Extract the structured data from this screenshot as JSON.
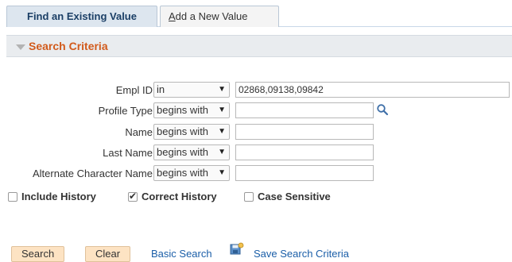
{
  "tabs": {
    "active": "Find an Existing Value",
    "inactive_accel": "A",
    "inactive_rest": "dd a New Value"
  },
  "section": {
    "title": "Search Criteria"
  },
  "fields": [
    {
      "label": "Empl ID",
      "operator": "in",
      "value": "02868,09138,09842"
    },
    {
      "label": "Profile Type",
      "operator": "begins with",
      "value": ""
    },
    {
      "label": "Name",
      "operator": "begins with",
      "value": ""
    },
    {
      "label": "Last Name",
      "operator": "begins with",
      "value": ""
    },
    {
      "label": "Alternate Character Name",
      "operator": "begins with",
      "value": ""
    }
  ],
  "caret": "▼",
  "checkboxes": [
    {
      "label": "Include History",
      "checked": false
    },
    {
      "label": "Correct History",
      "checked": true
    },
    {
      "label": "Case Sensitive",
      "checked": false
    }
  ],
  "buttons": {
    "search": "Search",
    "clear": "Clear"
  },
  "links": {
    "basic_search": "Basic Search",
    "save_search": "Save Search Criteria"
  },
  "colors": {
    "accent": "#d25b1c",
    "link": "#1a5ea8",
    "button_bg": "#fde3c3",
    "tab_active_bg": "#dde6ef"
  }
}
